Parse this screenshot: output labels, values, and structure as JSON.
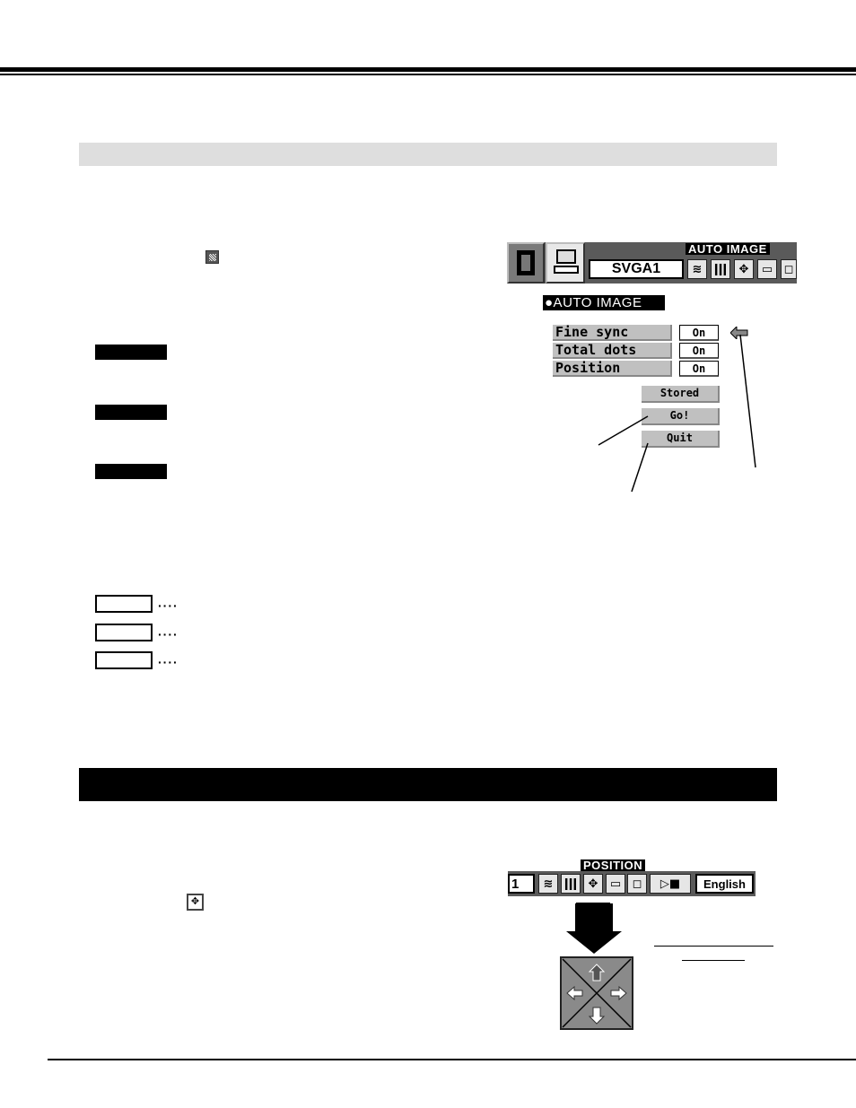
{
  "page": {
    "section1_banner": "",
    "section2_banner": "",
    "inline_icons": [
      "auto-image-icon",
      "position-icon"
    ]
  },
  "auto_image_osd": {
    "menubar_caption": "AUTO IMAGE",
    "source_field": "SVGA1",
    "menu_title": "●AUTO IMAGE",
    "menubar_icons": [
      "input-card-icon",
      "computer-icon",
      "auto-image-icon",
      "pc-adjust-icon",
      "position-icon",
      "image-select-icon",
      "screen-icon"
    ],
    "rows": [
      {
        "label": "Fine sync",
        "value": "On"
      },
      {
        "label": "Total dots",
        "value": "On"
      },
      {
        "label": "Position",
        "value": "On"
      }
    ],
    "buttons": [
      "Stored",
      "Go!",
      "Quit"
    ],
    "pointer_icon": "pointer-arrow-icon"
  },
  "position_osd": {
    "menubar_caption": "POSITION",
    "source_field_partial": "1",
    "language_field": "English",
    "menubar_icons": [
      "auto-image-icon",
      "pc-adjust-icon",
      "position-icon",
      "image-select-icon",
      "screen-icon",
      "projector-icon"
    ],
    "pad_arrows": [
      "up-arrow-icon",
      "left-arrow-icon",
      "right-arrow-icon",
      "down-arrow-icon"
    ]
  },
  "callouts": {
    "black_labels": [
      "",
      "",
      ""
    ],
    "box_labels": [
      "",
      "",
      ""
    ],
    "dots": "····"
  }
}
